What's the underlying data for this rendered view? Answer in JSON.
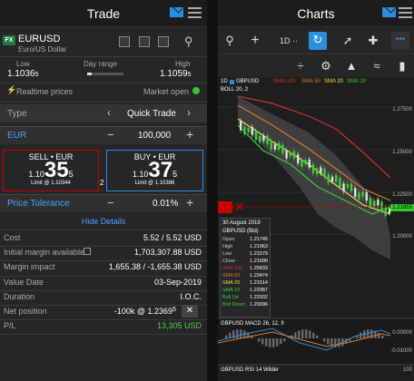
{
  "trade": {
    "title": "Trade",
    "symbol": "EURUSD",
    "symbol_name": "Euro/US Dollar",
    "fx_badge": "FX",
    "low_label": "Low",
    "low_value": "1.1036",
    "low_pip": "5",
    "day_range_label": "Day range",
    "high_label": "High",
    "high_value": "1.1059",
    "high_pip": "5",
    "realtime_label": "Realtime prices",
    "market_status": "Market open",
    "type_label": "Type",
    "type_value": "Quick Trade",
    "currency": "EUR",
    "amount": "100,000",
    "sell_label": "SELL • EUR",
    "sell_prefix": "1.10",
    "sell_big": "35",
    "sell_pip": "5",
    "sell_limit": "Limit @ 1.10344",
    "spread": "2",
    "buy_label": "BUY • EUR",
    "buy_prefix": "1.10",
    "buy_big": "37",
    "buy_pip": "5",
    "buy_limit": "Limit @ 1.10386",
    "price_tolerance_label": "Price Tolerance",
    "price_tolerance_value": "0.01%",
    "hide_details": "Hide Details",
    "details": [
      {
        "label": "Cost",
        "value": "5.52 / 5.52 USD"
      },
      {
        "label": "Initial margin available",
        "value": "1,703,307.88 USD"
      },
      {
        "label": "Margin impact",
        "value": "1,655.38 / -1,655.38 USD"
      },
      {
        "label": "Value Date",
        "value": "03-Sep-2019"
      },
      {
        "label": "Duration",
        "value": "I.O.C."
      },
      {
        "label": "Net position",
        "value": "-100k @ 1.2369"
      },
      {
        "label": "P/L",
        "value": "13,305 USD"
      }
    ],
    "net_position_suffix": "5"
  },
  "charts": {
    "title": "Charts",
    "timeframe": "1D",
    "instrument": "GBPUSD",
    "legend_sma100": "SMA 100",
    "legend_sma50": "SMA 50",
    "legend_sma20": "SMA 20",
    "legend_sma10": "SMA 10",
    "boll_label": "BOLL 20, 2",
    "y_ticks": [
      "1.27500",
      "1.25000",
      "1.22500",
      "1.20000"
    ],
    "current_price": "1.21955",
    "tooltip": {
      "date": "30 August 2019",
      "instrument": "GBPUSD (Bid)",
      "rows": [
        {
          "label": "Open",
          "value": "1.21745"
        },
        {
          "label": "High",
          "value": "1.21963"
        },
        {
          "label": "Low",
          "value": "1.21579"
        },
        {
          "label": "Close",
          "value": "1.21690"
        },
        {
          "label": "SMA 100",
          "value": "1.25833"
        },
        {
          "label": "SMA 50",
          "value": "1.23474"
        },
        {
          "label": "SMA 20",
          "value": "1.21514"
        },
        {
          "label": "SMA 10",
          "value": "1.22087"
        },
        {
          "label": "Boll Up",
          "value": "1.22932"
        },
        {
          "label": "Boll Down",
          "value": "1.20096"
        }
      ]
    },
    "macd_label": "GBPUSD  MACD 26, 12, 9",
    "macd_ticks": [
      "0.00000",
      "-0.01000"
    ],
    "rsi_label": "GBPUSD  RSI 14 Wilder",
    "rsi_tick": "100",
    "colors": {
      "sma100": "#d03030",
      "sma50": "#e07a2a",
      "sma20": "#f0e040",
      "sma10": "#3ad03a"
    }
  }
}
